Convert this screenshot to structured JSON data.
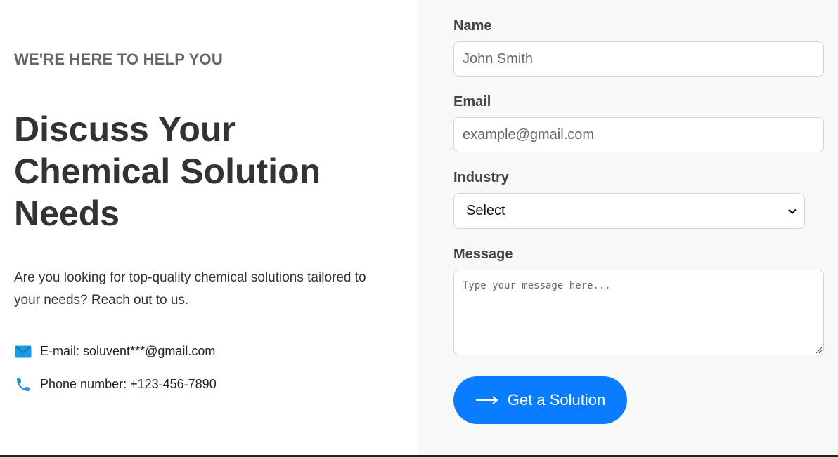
{
  "hero": {
    "eyebrow": "WE'RE HERE TO HELP YOU",
    "headline": "Discuss Your Chemical Solution Needs",
    "intro": "Are you looking for top-quality chemical solutions tailored to your needs? Reach out to us."
  },
  "contact": {
    "email_label": "E-mail: ",
    "email_value": "soluvent***@gmail.com",
    "email_icon": "envelope-icon",
    "phone_label": "Phone number: ",
    "phone_value": "+123-456-7890",
    "phone_icon": "phone-icon",
    "icon_color": "#1a9be6"
  },
  "form": {
    "name_label": "Name",
    "name_placeholder": "John Smith",
    "email_label": "Email",
    "email_placeholder": "example@gmail.com",
    "industry_label": "Industry",
    "industry_selected": "Select",
    "message_label": "Message",
    "message_placeholder": "Type your message here...",
    "submit_label": "Get a Solution",
    "submit_icon": "arrow-right-icon",
    "accent_color": "#0a7cff"
  }
}
